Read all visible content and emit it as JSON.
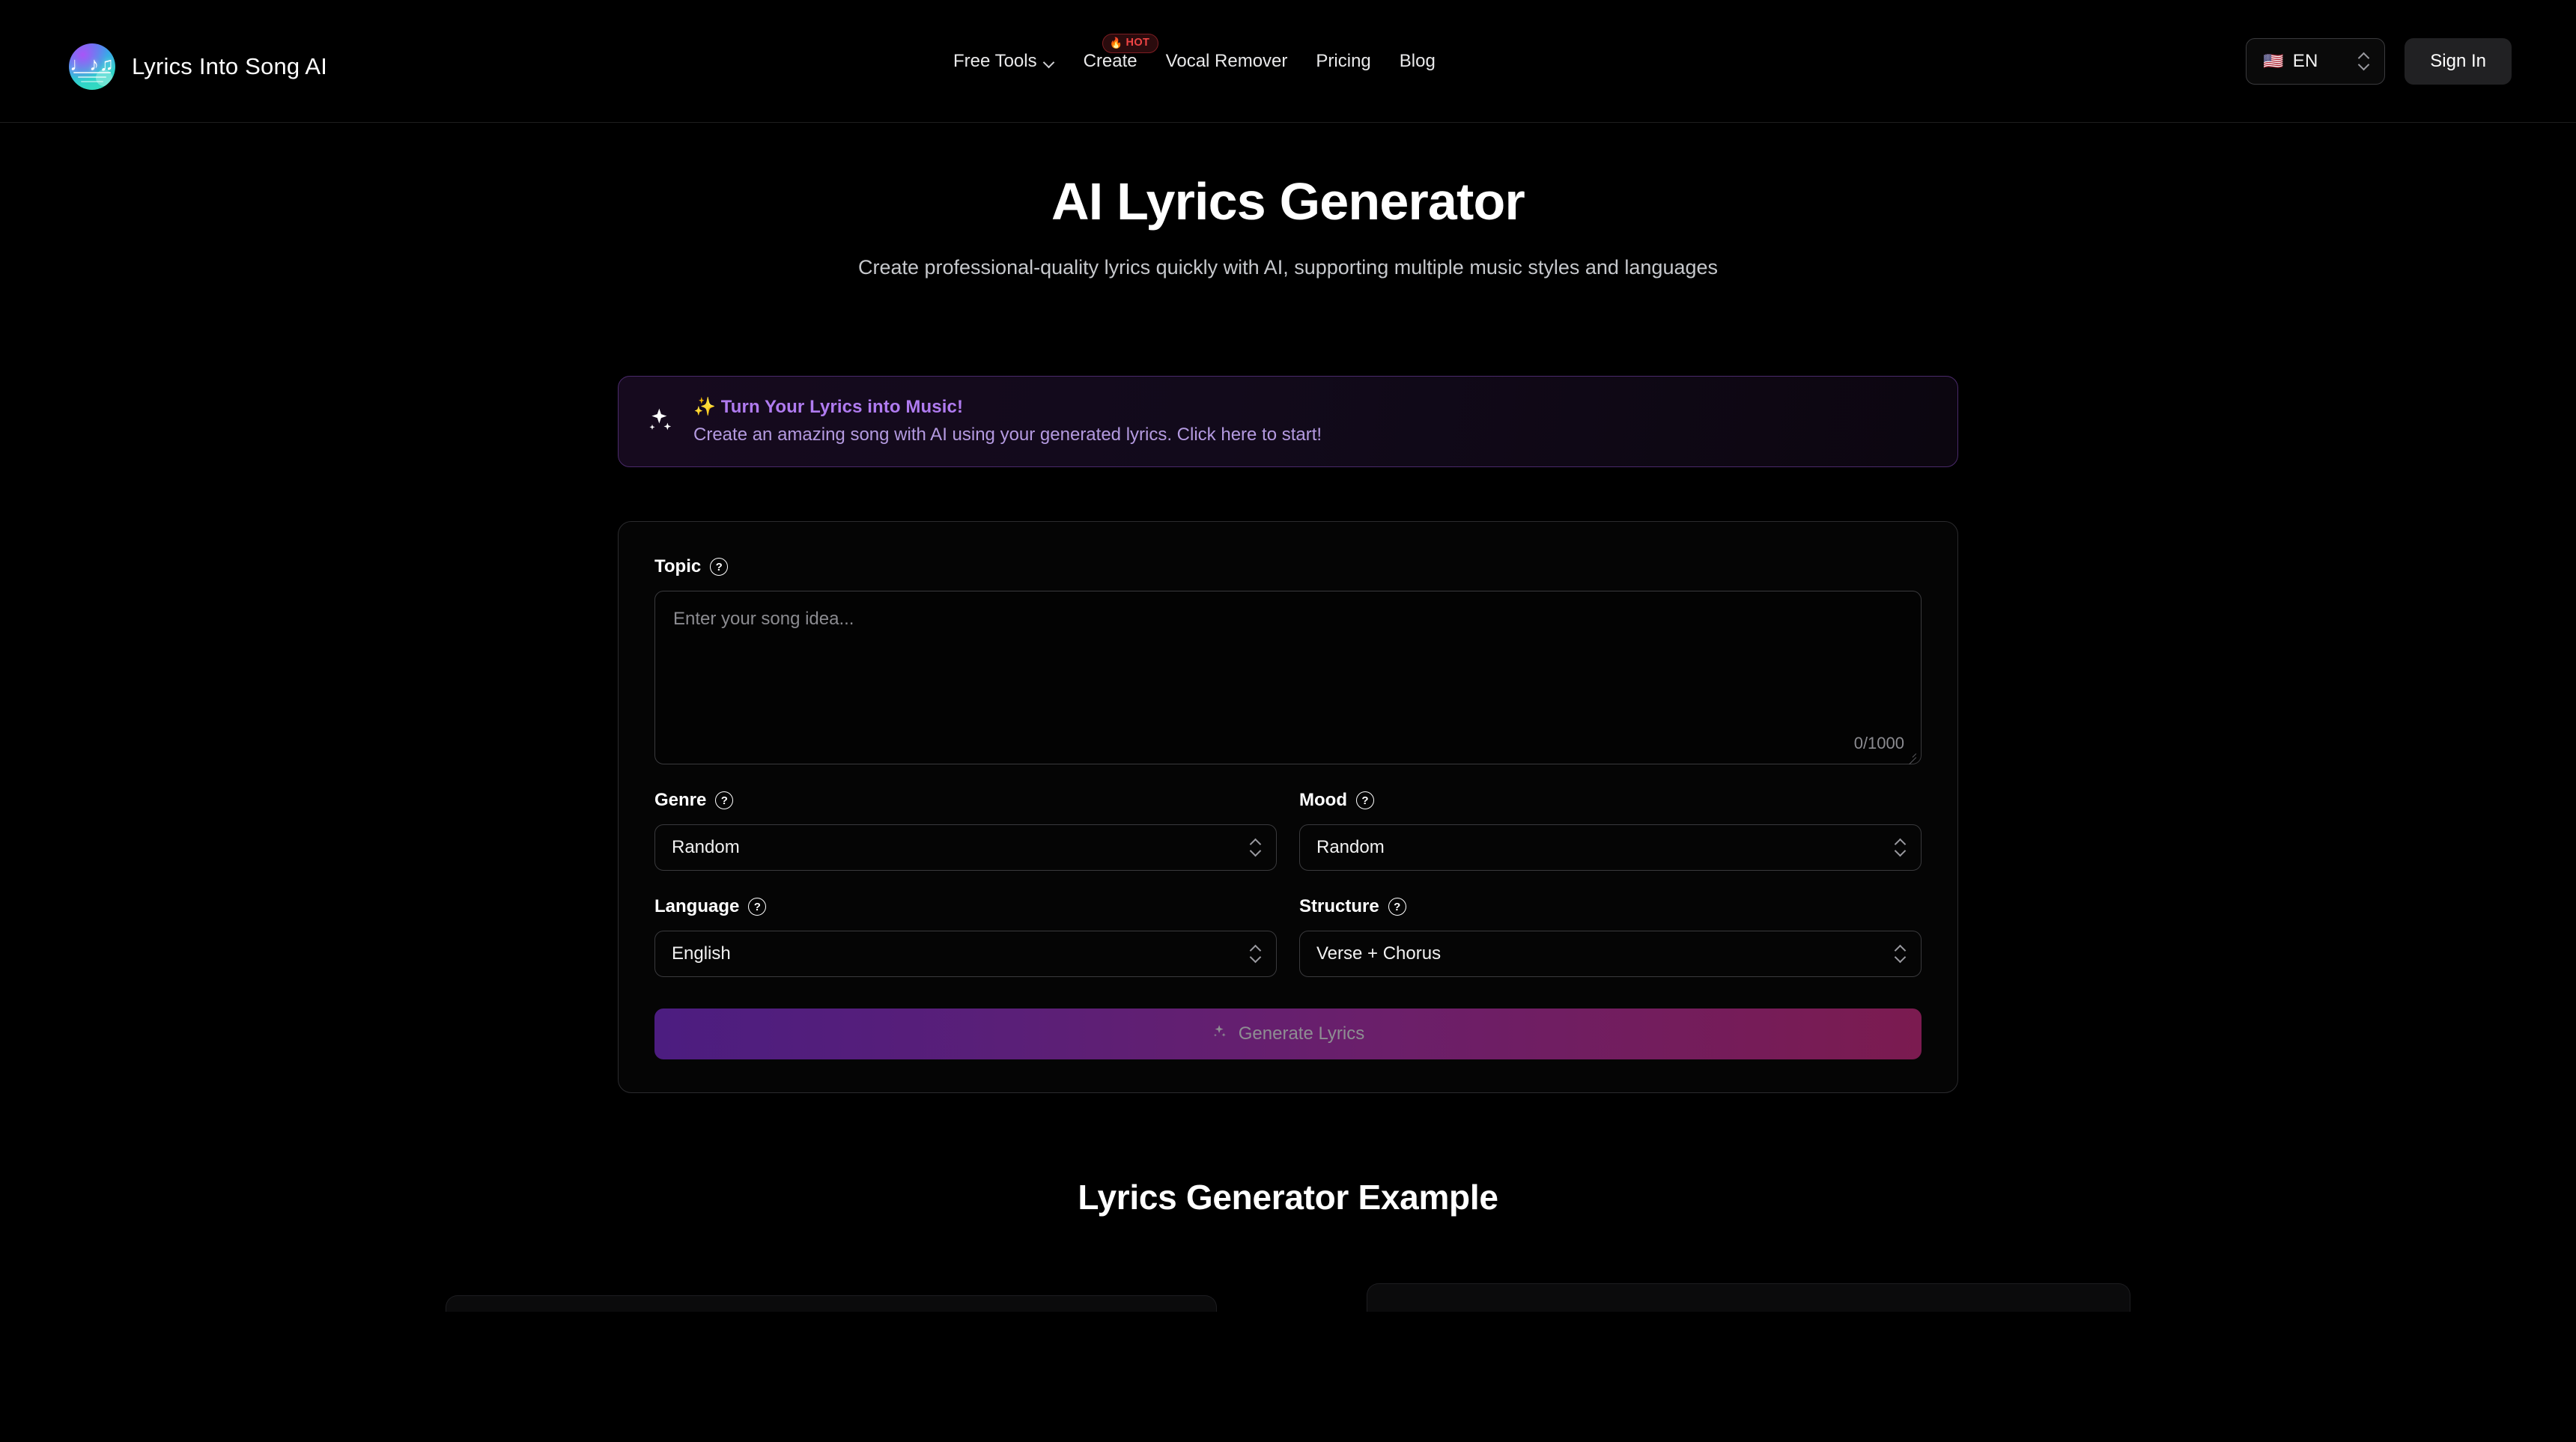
{
  "header": {
    "brand": {
      "name": "Lyrics Into Song AI",
      "logo_icon": "music-notes-logo-icon"
    },
    "nav": [
      {
        "label": "Free Tools",
        "has_dropdown": true,
        "icon": "chevron-down-icon"
      },
      {
        "label": "Create",
        "badge": "HOT",
        "badge_icon": "flame-icon"
      },
      {
        "label": "Vocal Remover"
      },
      {
        "label": "Pricing"
      },
      {
        "label": "Blog"
      }
    ],
    "language": {
      "flag": "🇺🇸",
      "code": "EN",
      "icon": "up-down-chevrons-icon"
    },
    "sign_in_label": "Sign In"
  },
  "hero": {
    "title": "AI Lyrics Generator",
    "subtitle": "Create professional-quality lyrics quickly with AI, supporting multiple music styles and languages"
  },
  "promo": {
    "icon": "sparkles-icon",
    "emoji": "✨",
    "title": "Turn Your Lyrics into Music!",
    "description": "Create an amazing song with AI using your generated lyrics. Click here to start!",
    "accent_color": "#b07bf0",
    "border_color": "#4a2a6b"
  },
  "form": {
    "topic": {
      "label": "Topic",
      "help_icon": "question-mark-circle-icon",
      "placeholder": "Enter your song idea...",
      "value": "",
      "char_count": "0/1000",
      "max_length": 1000
    },
    "genre": {
      "label": "Genre",
      "help_icon": "question-mark-circle-icon",
      "value": "Random",
      "icon": "up-down-chevrons-icon"
    },
    "mood": {
      "label": "Mood",
      "help_icon": "question-mark-circle-icon",
      "value": "Random",
      "icon": "up-down-chevrons-icon"
    },
    "language": {
      "label": "Language",
      "help_icon": "question-mark-circle-icon",
      "value": "English",
      "icon": "up-down-chevrons-icon"
    },
    "structure": {
      "label": "Structure",
      "help_icon": "question-mark-circle-icon",
      "value": "Verse + Chorus",
      "icon": "up-down-chevrons-icon"
    },
    "submit": {
      "label": "Generate Lyrics",
      "icon": "sparkles-icon",
      "disabled": true,
      "gradient_start": "#4c1d80",
      "gradient_end": "#7b1b50"
    }
  },
  "example_section": {
    "title": "Lyrics Generator Example"
  },
  "colors": {
    "background": "#000000",
    "card_border": "#2b2b2e",
    "input_border": "#3a3a3d",
    "muted_text": "#8b8b90",
    "hot_badge": "#ef4444"
  },
  "help_glyph": "?"
}
